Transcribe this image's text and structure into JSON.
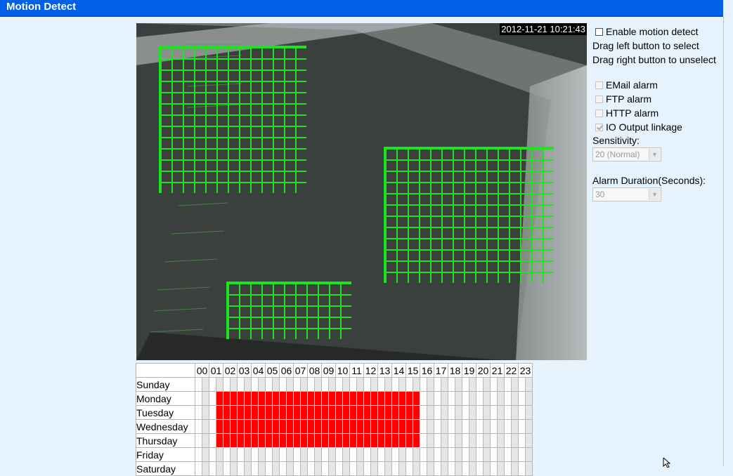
{
  "title": "Motion Detect",
  "camera": {
    "timestamp": "2012-11-21 10:21:43"
  },
  "panel": {
    "enable_label": "Enable motion detect",
    "hint_select": "Drag left button to select",
    "hint_unselect": "Drag right button to unselect",
    "email_label": "EMail alarm",
    "ftp_label": "FTP alarm",
    "http_label": "HTTP alarm",
    "io_label": "IO Output linkage",
    "sensitivity_label": "Sensitivity:",
    "sensitivity_value": "20 (Normal)",
    "duration_label": "Alarm Duration(Seconds):",
    "duration_value": "30"
  },
  "checkboxes": {
    "enable": false,
    "email": false,
    "ftp": false,
    "http": false,
    "io": true
  },
  "schedule": {
    "hours": [
      "00",
      "01",
      "02",
      "03",
      "04",
      "05",
      "06",
      "07",
      "08",
      "09",
      "10",
      "11",
      "12",
      "13",
      "14",
      "15",
      "16",
      "17",
      "18",
      "19",
      "20",
      "21",
      "22",
      "23"
    ],
    "days": [
      "Sunday",
      "Monday",
      "Tuesday",
      "Wednesday",
      "Thursday",
      "Friday",
      "Saturday"
    ],
    "active_days": [
      "Monday",
      "Tuesday",
      "Wednesday",
      "Thursday"
    ],
    "active_hours_start": 1.5,
    "active_hours_end": 16
  },
  "colors": {
    "titlebar": "#0060e8",
    "zone_grid": "#1be61b",
    "schedule_active": "#ff0000"
  }
}
